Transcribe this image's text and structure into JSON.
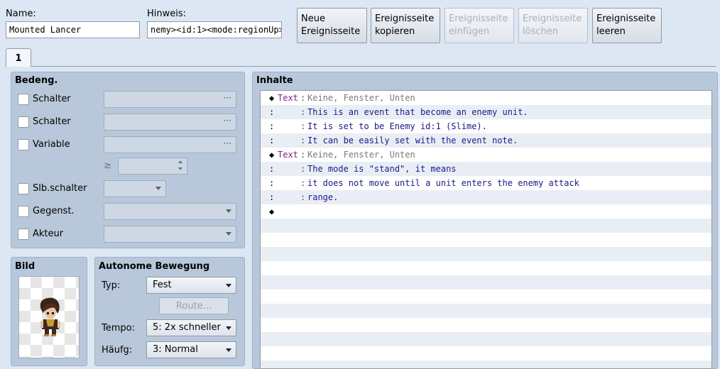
{
  "header": {
    "name_label": "Name:",
    "name_value": "Mounted Lancer",
    "note_label": "Hinweis:",
    "note_value": "nemy><id:1><mode:regionUp>"
  },
  "page_buttons": {
    "new_line1": "Neue",
    "new_line2": "Ereignisseite",
    "copy_line1": "Ereignisseite",
    "copy_line2": "kopieren",
    "paste_line1": "Ereignisseite",
    "paste_line2": "einfügen",
    "delete_line1": "Ereignisseite",
    "delete_line2": "löschen",
    "clear_line1": "Ereignisseite",
    "clear_line2": "leeren"
  },
  "tabs": [
    {
      "label": "1"
    }
  ],
  "conditions": {
    "title": "Bedeng.",
    "items": [
      {
        "label": "Schalter",
        "checked": false
      },
      {
        "label": "Schalter",
        "checked": false
      },
      {
        "label": "Variable",
        "checked": false
      },
      {
        "label": "Slb.schalter",
        "checked": false
      },
      {
        "label": "Gegenst.",
        "checked": false
      },
      {
        "label": "Akteur",
        "checked": false
      }
    ],
    "ge_symbol": "≥",
    "field_dots": "···"
  },
  "image": {
    "title": "Bild"
  },
  "movement": {
    "title": "Autonome Bewegung",
    "type_label": "Typ:",
    "type_value": "Fest",
    "route_label": "Route...",
    "speed_label": "Tempo:",
    "speed_value": "5: 2x schneller",
    "freq_label": "Häufg:",
    "freq_value": "3: Normal"
  },
  "contents": {
    "title": "Inhalte",
    "rows": [
      {
        "marker": "◆",
        "cmd": "Text",
        "sep": ":",
        "text": "Keine, Fenster, Unten",
        "style": "gray"
      },
      {
        "marker": ":",
        "cmd": "",
        "sep": ":",
        "text": "This is an event that become an enemy unit.",
        "style": "blue"
      },
      {
        "marker": ":",
        "cmd": "",
        "sep": ":",
        "text": "It is set to be Enemy id:1 (Slime).",
        "style": "blue"
      },
      {
        "marker": ":",
        "cmd": "",
        "sep": ":",
        "text": "It can be easily set with the event note.",
        "style": "blue"
      },
      {
        "marker": "◆",
        "cmd": "Text",
        "sep": ":",
        "text": "Keine, Fenster, Unten",
        "style": "gray"
      },
      {
        "marker": ":",
        "cmd": "",
        "sep": ":",
        "text": "The mode is \"stand\", it means",
        "style": "blue"
      },
      {
        "marker": ":",
        "cmd": "",
        "sep": ":",
        "text": "it does not move until a unit enters the enemy attack",
        "style": "blue"
      },
      {
        "marker": ":",
        "cmd": "",
        "sep": ":",
        "text": "range.",
        "style": "blue"
      },
      {
        "marker": "◆",
        "cmd": "",
        "sep": "",
        "text": "",
        "style": "blue"
      }
    ]
  }
}
